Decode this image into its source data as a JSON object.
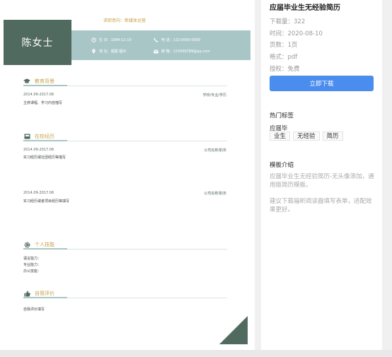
{
  "resume": {
    "intent": "求职意向：新媒体运营",
    "name": "陈女士",
    "birth": "生 日：1994-11-10",
    "phone": "电 话：132-0000-0000",
    "address": "地 址：福建·福州",
    "email": "邮 箱：123456789@qq.com",
    "sections": {
      "education": {
        "title": "教育背景",
        "date": "2014.09-2017.06",
        "right": "学校/专业/学历",
        "text": "主修课程、学习内容描写"
      },
      "campus": {
        "title": "在校经历",
        "entries": [
          {
            "date": "2014.09-2017.06",
            "right": "公司名称/职务",
            "text": "实习经历或社团经历等描写"
          },
          {
            "date": "2014.09-2017.06",
            "right": "公司名称/职务",
            "text": "实习经历或者项目经历等填写"
          }
        ]
      },
      "skills": {
        "title": "个人技能",
        "lines": [
          "语言能力：",
          "专业能力：",
          "办公技能："
        ]
      },
      "evaluation": {
        "title": "自我评价",
        "text": "自我评价填写"
      }
    },
    "colors": {
      "accent_dark": "#516a5f",
      "accent_light": "#a9c6c6",
      "gold": "#c9a24a"
    }
  },
  "sidebar": {
    "title": "应届毕业生无经验简历",
    "downloads": "下载量：322",
    "time": "时间：2020-08-10",
    "pages": "页数：1页",
    "format": "格式：pdf",
    "license": "授权：免费",
    "download_button": "立即下载",
    "tags_heading": "热门标签",
    "tags": [
      "应届毕",
      "业生",
      "无经验",
      "简历"
    ],
    "template_heading": "模板介绍",
    "template_desc": "应届毕业生无经验简历-无头像添加，通用版简历模板。",
    "template_tip": "建议下载福昕阅读器填写表单，适配效果更好。",
    "colors": {
      "button": "#4a8dee"
    }
  }
}
